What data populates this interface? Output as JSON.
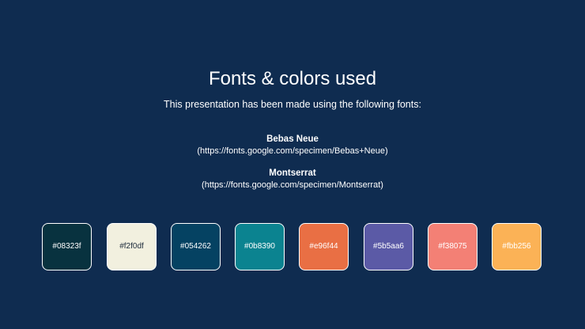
{
  "slide": {
    "title": "Fonts & colors used",
    "subtitle": "This presentation has been made using the following fonts:",
    "fonts": [
      {
        "name": "Bebas Neue",
        "url": "(https://fonts.google.com/specimen/Bebas+Neue)"
      },
      {
        "name": "Montserrat",
        "url": "(https://fonts.google.com/specimen/Montserrat)"
      }
    ],
    "palette": [
      {
        "hex": "#08323f",
        "label": "#08323f"
      },
      {
        "hex": "#f2f0df",
        "label": "#f2f0df"
      },
      {
        "hex": "#054262",
        "label": "#054262"
      },
      {
        "hex": "#0b8390",
        "label": "#0b8390"
      },
      {
        "hex": "#e96f44",
        "label": "#e96f44"
      },
      {
        "hex": "#5b5aa6",
        "label": "#5b5aa6"
      },
      {
        "hex": "#f38075",
        "label": "#f38075"
      },
      {
        "hex": "#fbb256",
        "label": "#fbb256"
      }
    ],
    "background_color": "#0f2c50"
  }
}
